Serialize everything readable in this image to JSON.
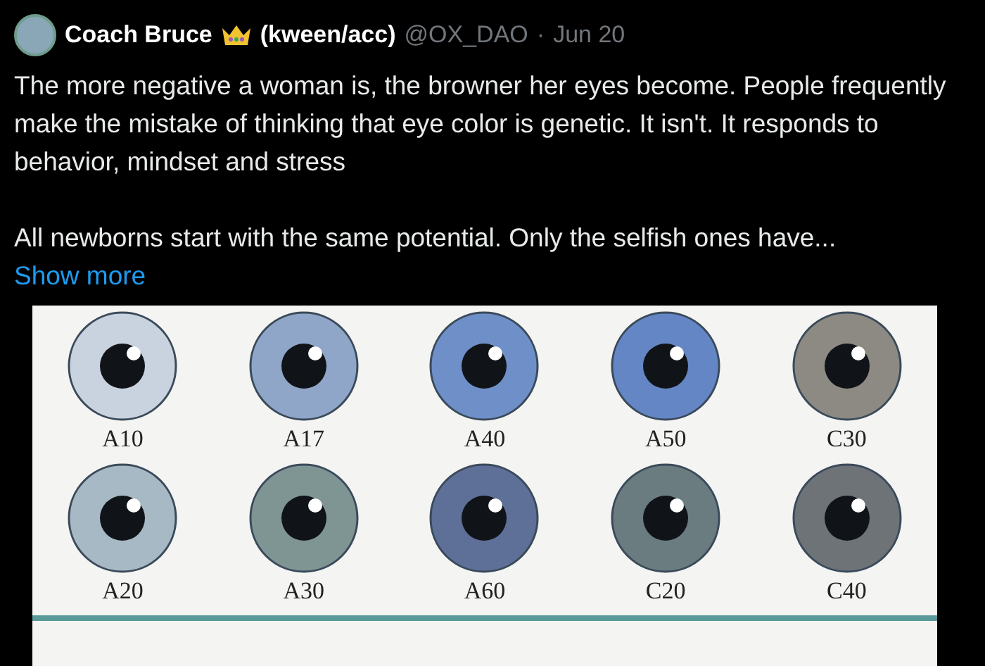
{
  "author": {
    "name": "Coach Bruce",
    "name_suffix": "(kween/acc)",
    "handle": "@OX_DAO",
    "separator": "·",
    "date": "Jun 20"
  },
  "paragraphs": [
    "The more negative a woman is, the browner her eyes become. People frequently make the mistake of thinking that eye color is genetic. It isn't. It responds to behavior, mindset and stress",
    "All newborns start with the same potential. Only the selfish ones have..."
  ],
  "show_more": "Show more",
  "image": {
    "eyes": [
      {
        "label": "A10",
        "color": "#c9d3e0"
      },
      {
        "label": "A17",
        "color": "#8fa6c8"
      },
      {
        "label": "A40",
        "color": "#6f8fc8"
      },
      {
        "label": "A50",
        "color": "#6486c4"
      },
      {
        "label": "C30",
        "color": "#8c8a82"
      },
      {
        "label": "A20",
        "color": "#a7b9c4"
      },
      {
        "label": "A30",
        "color": "#7f9594"
      },
      {
        "label": "A60",
        "color": "#5e6f98"
      },
      {
        "label": "C20",
        "color": "#6a7c80"
      },
      {
        "label": "C40",
        "color": "#6e7378"
      }
    ]
  }
}
